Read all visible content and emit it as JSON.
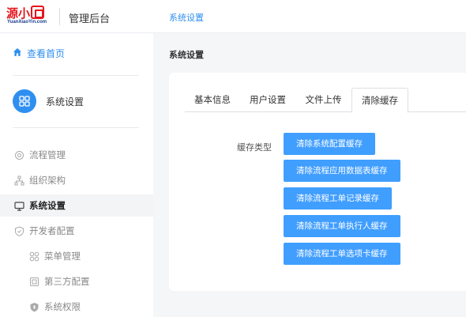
{
  "header": {
    "logo_text": "源小",
    "logo_subtext": "YuanXiaoYin.com",
    "app_title": "管理后台",
    "active_tab": "系统设置"
  },
  "sidebar": {
    "home_label": "查看首页",
    "module_label": "系统设置",
    "items": [
      {
        "label": "流程管理",
        "icon": "workflow-icon",
        "level": 1,
        "active": false
      },
      {
        "label": "组织架构",
        "icon": "org-chart-icon",
        "level": 1,
        "active": false
      },
      {
        "label": "系统设置",
        "icon": "monitor-icon",
        "level": 1,
        "active": true
      },
      {
        "label": "开发者配置",
        "icon": "shield-icon",
        "level": 1,
        "active": false
      },
      {
        "label": "菜单管理",
        "icon": "grid-icon",
        "level": 2,
        "active": false
      },
      {
        "label": "第三方配置",
        "icon": "box-icon",
        "level": 2,
        "active": false
      },
      {
        "label": "系统权限",
        "icon": "shield-filled-icon",
        "level": 2,
        "active": false
      }
    ]
  },
  "main": {
    "page_title": "系统设置",
    "tabs": [
      {
        "label": "基本信息",
        "active": false
      },
      {
        "label": "用户设置",
        "active": false
      },
      {
        "label": "文件上传",
        "active": false
      },
      {
        "label": "清除缓存",
        "active": true
      }
    ],
    "cache_type_label": "缓存类型",
    "buttons": [
      "清除系统配置缓存",
      "清除流程应用数据表缓存",
      "清除流程工单记录缓存",
      "清除流程工单执行人缓存",
      "清除流程工单选项卡缓存"
    ]
  },
  "colors": {
    "primary": "#409eff",
    "accent_link": "#2f8ff0",
    "brand_red": "#e5161d"
  }
}
